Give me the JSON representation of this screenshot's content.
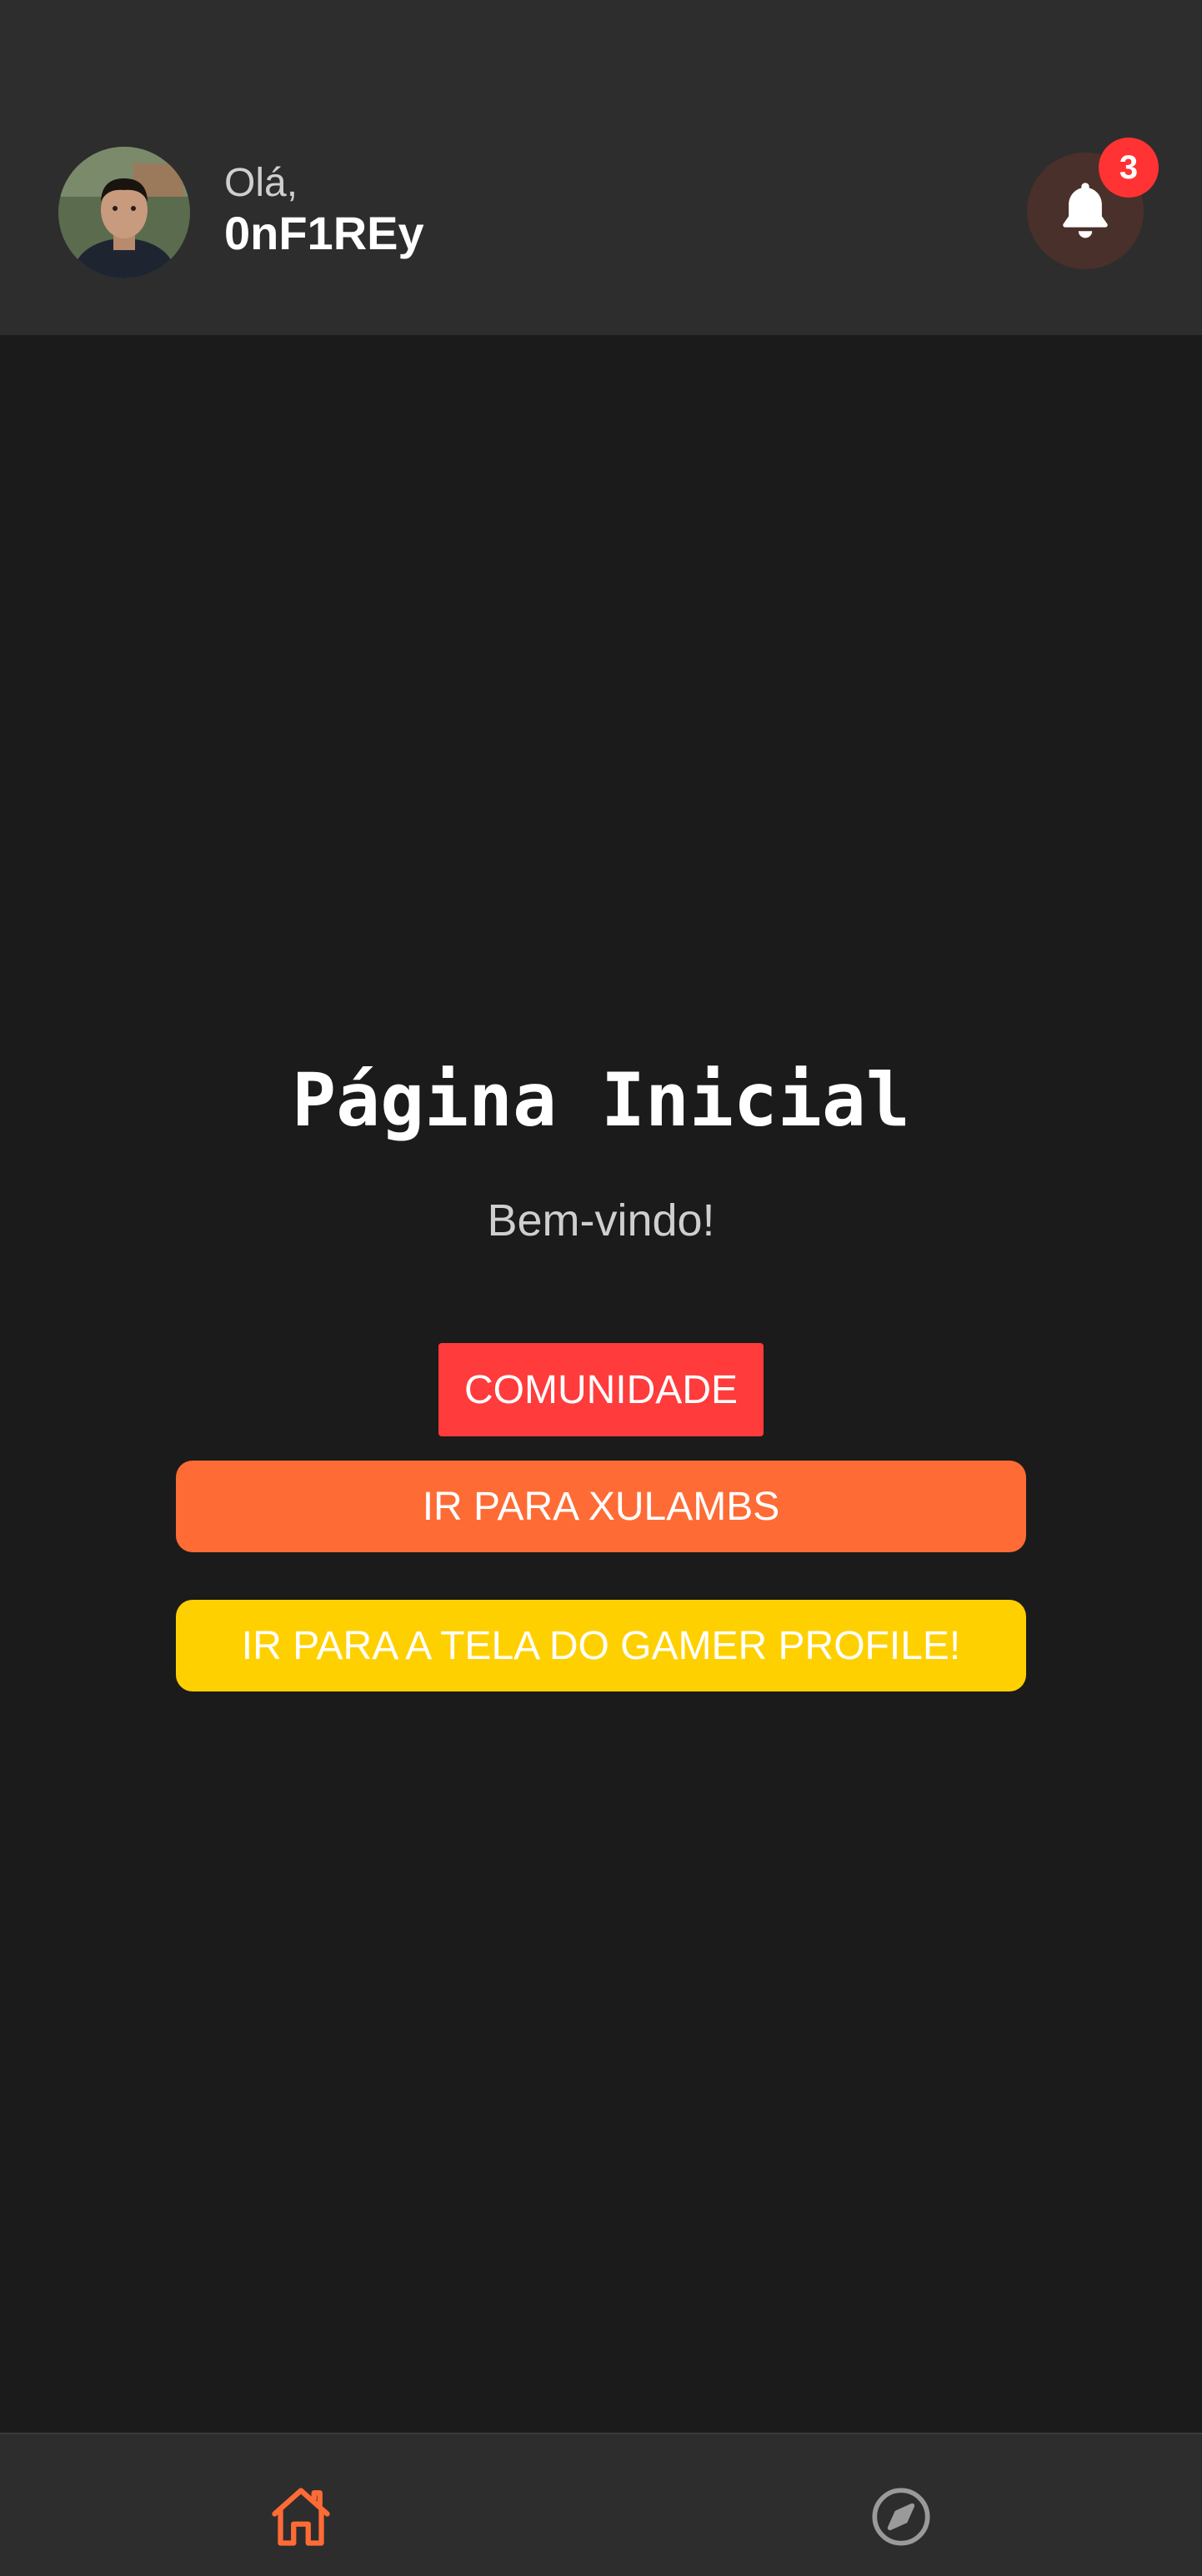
{
  "header": {
    "greeting": "Olá,",
    "username": "0nF1REy",
    "notifications_count": "3"
  },
  "main": {
    "title": "Página Inicial",
    "subtitle": "Bem-vindo!",
    "buttons": {
      "community": "COMUNIDADE",
      "xulambs": "IR PARA XULAMBS",
      "gamer_profile": "IR PARA A TELA DO GAMER PROFILE!"
    }
  },
  "nav": {
    "items": [
      {
        "icon": "home-icon",
        "active": true
      },
      {
        "icon": "compass-icon",
        "active": false
      }
    ]
  },
  "colors": {
    "background": "#1b1b1b",
    "header": "#2d2d2d",
    "accent_orange": "#ff6b35",
    "accent_red": "#ff3b3b",
    "accent_yellow": "#ffd000",
    "badge": "#ff3333"
  }
}
